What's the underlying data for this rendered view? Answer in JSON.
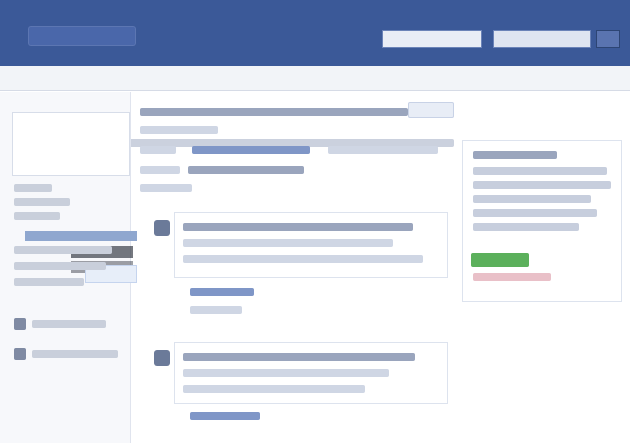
{
  "app": {
    "title": "",
    "topbar": {
      "logo_text": "",
      "search_placeholder": "",
      "password_placeholder": "",
      "login_label": ""
    },
    "notice": {
      "badge_text": "",
      "message": ""
    },
    "sidebar": {
      "header": "",
      "items": [
        "",
        "",
        "",
        "",
        "",
        "",
        "",
        ""
      ]
    },
    "main": {
      "heading": "",
      "subheading": "",
      "posts": [
        {
          "title": "",
          "meta": "",
          "snippet": ""
        },
        {
          "title": "",
          "meta": "",
          "snippet": ""
        }
      ]
    },
    "right_panel": {
      "heading": "",
      "lines": [
        "",
        "",
        "",
        "",
        ""
      ],
      "cta_label": "",
      "footer_note": ""
    }
  },
  "colors": {
    "brand": "#3b5998",
    "accent_green": "#5cb05c"
  }
}
